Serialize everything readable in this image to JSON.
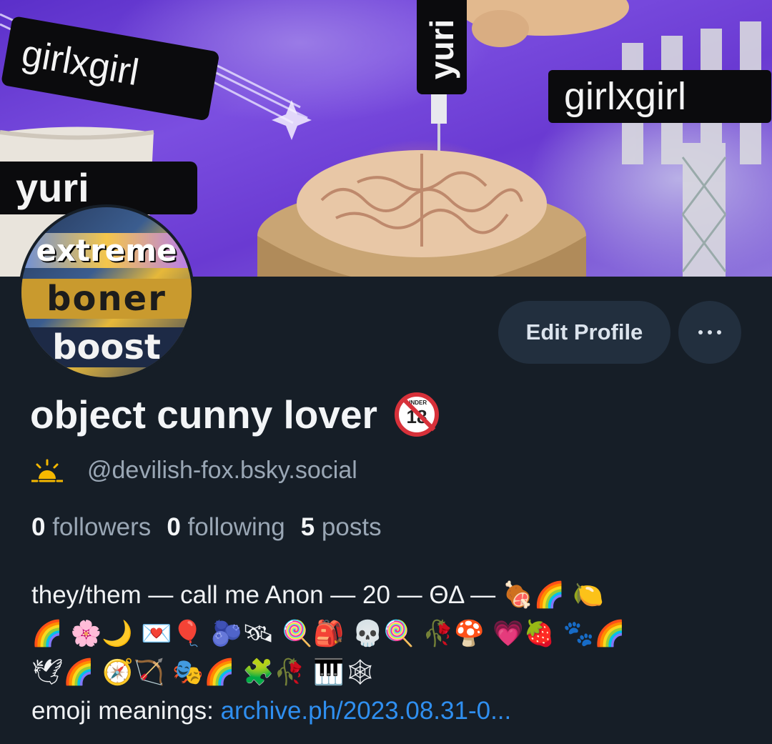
{
  "banner": {
    "tags": [
      "girlxgirl",
      "yuri",
      "girlxgirl",
      "yuri"
    ]
  },
  "avatar": {
    "lines": [
      "extreme",
      "boner",
      "boost"
    ]
  },
  "actions": {
    "edit_label": "Edit Profile"
  },
  "profile": {
    "display_name": "object cunny lover",
    "badge": "18",
    "badge_small": "UNDER",
    "handle": "@devilish-fox.bsky.social"
  },
  "stats": {
    "followers_count": "0",
    "followers_label": "followers",
    "following_count": "0",
    "following_label": "following",
    "posts_count": "5",
    "posts_label": "posts"
  },
  "bio": {
    "line1_text": "they/them — call me Anon — 20 — ΘΔ — ",
    "line1_emoji": "🍖🌈 🍋",
    "line2_emoji": "🌈 🌸🌙 💌🎈 🫐🛰 🍭🎒 💀🍭 🥀🍄 💗🍓 🐾🌈",
    "line3_emoji": "🕊🌈 🧭🏹 🎭🌈 🧩🥀 🎹🕸",
    "link_prefix": "emoji meanings: ",
    "link_text": "archive.ph/2023.08.31-0..."
  }
}
